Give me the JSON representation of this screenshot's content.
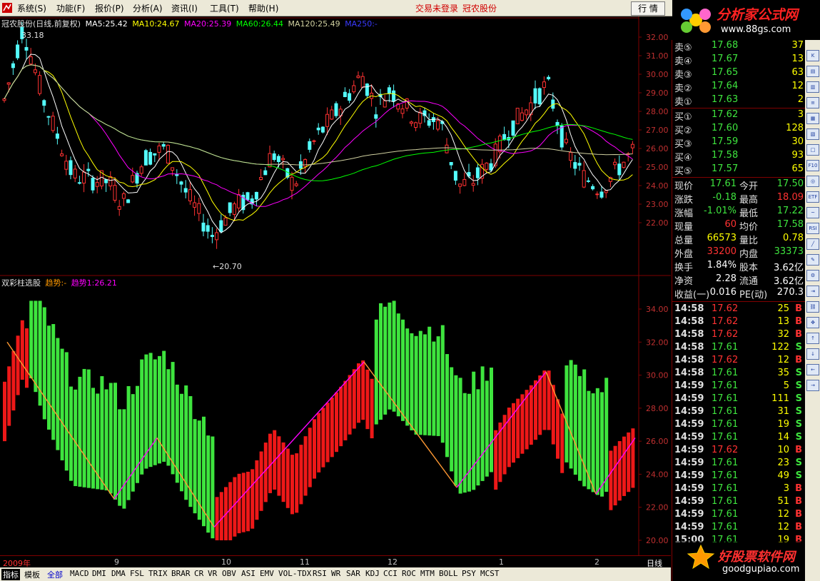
{
  "menu": {
    "items": [
      "系统(S)",
      "功能(F)",
      "报价(P)",
      "分析(A)",
      "资讯(I)",
      "工具(T)",
      "帮助(H)"
    ],
    "status": "交易未登录",
    "stock": "冠农股份",
    "btn_quote": "行 情",
    "btn_trade": "资讯"
  },
  "brand": {
    "title": "分析家公式网",
    "url": "www.88gs.com"
  },
  "bottom_brand": {
    "title": "好股票软件网",
    "url": "goodgupiao.com"
  },
  "main_chart": {
    "header": {
      "name": "冠农股份(日线,前复权)",
      "ma5": "MA5:25.42",
      "ma10": "MA10:24.67",
      "ma20": "MA20:25.39",
      "ma60": "MA60:26.44",
      "ma120": "MA120:25.49",
      "ma250": "MA250:-"
    },
    "high_label": "33.18",
    "low_label": "←20.70",
    "yticks": [
      "32.00",
      "31.00",
      "30.00",
      "29.00",
      "28.00",
      "27.00",
      "26.00",
      "25.00",
      "24.00",
      "23.00",
      "22.00"
    ]
  },
  "indicator": {
    "header": {
      "name": "双彩柱选股",
      "t1": "趋势:-",
      "t2": "趋势1:26.21"
    },
    "yticks": [
      "34.00",
      "32.00",
      "30.00",
      "28.00",
      "26.00",
      "24.00",
      "22.00",
      "20.00"
    ]
  },
  "axis": {
    "labels": [
      "2009年",
      "9",
      "10",
      "11",
      "12",
      "1",
      "2"
    ],
    "period": "日线"
  },
  "tabs": [
    "指标",
    "模板",
    "全部",
    "MACD",
    "DMI",
    "DMA",
    "FSL",
    "TRIX",
    "BRAR",
    "CR",
    "VR",
    "OBV",
    "ASI",
    "EMV",
    "VOL-TDX",
    "RSI",
    "WR",
    "SAR",
    "KDJ",
    "CCI",
    "ROC",
    "MTM",
    "BOLL",
    "PSY",
    "MCST"
  ],
  "quote": {
    "sell": [
      [
        "卖⑤",
        "17.68",
        "37"
      ],
      [
        "卖④",
        "17.67",
        "13"
      ],
      [
        "卖③",
        "17.65",
        "63"
      ],
      [
        "卖②",
        "17.64",
        "12"
      ],
      [
        "卖①",
        "17.63",
        "2"
      ]
    ],
    "buy": [
      [
        "买①",
        "17.62",
        "3"
      ],
      [
        "买②",
        "17.60",
        "128"
      ],
      [
        "买③",
        "17.59",
        "30"
      ],
      [
        "买④",
        "17.58",
        "93"
      ],
      [
        "买⑤",
        "17.57",
        "65"
      ]
    ],
    "stats": [
      [
        "现价",
        "17.61",
        "今开",
        "17.50"
      ],
      [
        "涨跌",
        "-0.18",
        "最高",
        "18.09"
      ],
      [
        "涨幅",
        "-1.01%",
        "最低",
        "17.22"
      ],
      [
        "现量",
        "60",
        "均价",
        "17.58"
      ],
      [
        "总量",
        "66573",
        "量比",
        "0.78"
      ],
      [
        "外盘",
        "33200",
        "内盘",
        "33373"
      ],
      [
        "换手",
        "1.84%",
        "股本",
        "3.62亿"
      ],
      [
        "净资",
        "2.28",
        "流通",
        "3.62亿"
      ],
      [
        "收益(一)",
        "0.016",
        "PE(动)",
        "270.3"
      ]
    ],
    "trades": [
      [
        "14:58",
        "17.62",
        "25",
        "B"
      ],
      [
        "14:58",
        "17.62",
        "13",
        "B"
      ],
      [
        "14:58",
        "17.62",
        "32",
        "B"
      ],
      [
        "14:58",
        "17.61",
        "122",
        "S"
      ],
      [
        "14:58",
        "17.62",
        "12",
        "B"
      ],
      [
        "14:58",
        "17.61",
        "35",
        "S"
      ],
      [
        "14:59",
        "17.61",
        "5",
        "S"
      ],
      [
        "14:59",
        "17.61",
        "111",
        "S"
      ],
      [
        "14:59",
        "17.61",
        "31",
        "S"
      ],
      [
        "14:59",
        "17.61",
        "19",
        "S"
      ],
      [
        "14:59",
        "17.61",
        "14",
        "S"
      ],
      [
        "14:59",
        "17.62",
        "10",
        "B"
      ],
      [
        "14:59",
        "17.61",
        "23",
        "S"
      ],
      [
        "14:59",
        "17.61",
        "49",
        "S"
      ],
      [
        "14:59",
        "17.61",
        "3",
        "B"
      ],
      [
        "14:59",
        "17.61",
        "51",
        "B"
      ],
      [
        "14:59",
        "17.61",
        "12",
        "B"
      ],
      [
        "14:59",
        "17.61",
        "12",
        "B"
      ],
      [
        "15:00",
        "17.61",
        "19",
        "B"
      ]
    ]
  },
  "colors": {
    "up": "#ff3232",
    "down": "#54fcfc",
    "green": "#3ee43e",
    "red": "#ee1818",
    "ma5": "#ffffff",
    "ma10": "#ffff00",
    "ma20": "#ff00ff",
    "ma60": "#00ff00",
    "ma120": "#d0d0a0",
    "ma250": "#0000ff"
  }
}
